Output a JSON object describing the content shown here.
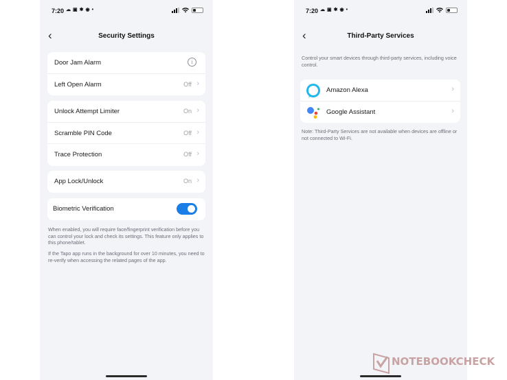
{
  "status_bar": {
    "time": "7:20",
    "app_icons": [
      "notification-icon",
      "linkedin-icon",
      "slack-icon",
      "pinterest-icon",
      "dot-icon"
    ],
    "right_icons": [
      "signal-icon",
      "wifi-icon",
      "battery-icon"
    ]
  },
  "left_screen": {
    "title": "Security Settings",
    "groups": [
      {
        "rows": [
          {
            "label": "Door Jam Alarm",
            "value": "",
            "trailing": "info-icon"
          },
          {
            "label": "Left Open Alarm",
            "value": "Off",
            "trailing": "chevron-right-icon"
          }
        ]
      },
      {
        "rows": [
          {
            "label": "Unlock Attempt Limiter",
            "value": "On",
            "trailing": "chevron-right-icon"
          },
          {
            "label": "Scramble PIN Code",
            "value": "Off",
            "trailing": "chevron-right-icon"
          },
          {
            "label": "Trace Protection",
            "value": "Off",
            "trailing": "chevron-right-icon"
          }
        ]
      },
      {
        "rows": [
          {
            "label": "App Lock/Unlock",
            "value": "On",
            "trailing": "chevron-right-icon"
          }
        ]
      }
    ],
    "biometric": {
      "label": "Biometric Verification",
      "enabled": true,
      "accent_color": "#1a7ee6"
    },
    "help_text_1": "When enabled, you will require face/fingerprint verification before you can control your lock and check its settings. This feature only applies to this phone/tablet.",
    "help_text_2": "If the Tapo app runs in the background for over 10 minutes, you need to re-verify when accessing the related pages of the app."
  },
  "right_screen": {
    "title": "Third-Party Services",
    "description": "Control your smart devices through third-party services, including voice control.",
    "services": [
      {
        "label": "Amazon Alexa",
        "logo": "alexa-logo-icon"
      },
      {
        "label": "Google Assistant",
        "logo": "google-assistant-logo-icon"
      }
    ],
    "note": "Note: Third-Party Services are not available when devices are offline or not connected to Wi-Fi."
  },
  "watermark": {
    "text": "NOTEBOOKCHECK"
  }
}
